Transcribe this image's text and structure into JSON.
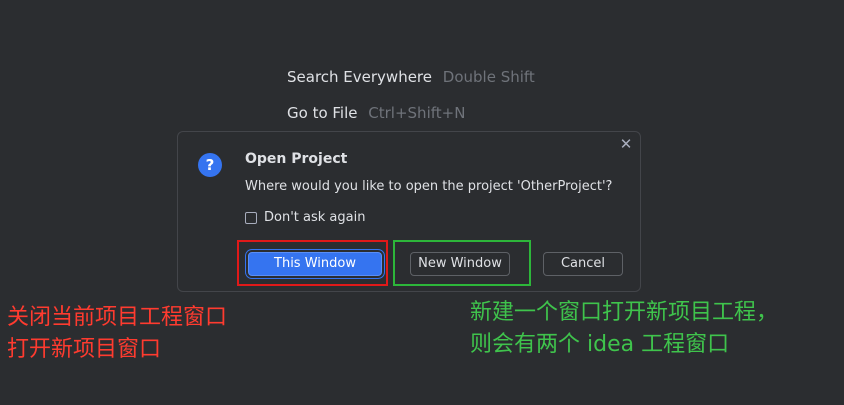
{
  "background_hints": [
    {
      "action": "Search Everywhere",
      "shortcut": "Double Shift"
    },
    {
      "action": "Go to File",
      "shortcut": "Ctrl+Shift+N"
    }
  ],
  "dialog": {
    "title": "Open Project",
    "message": "Where would you like to open the project 'OtherProject'?",
    "checkbox_label": "Don't ask again",
    "checkbox_checked": false,
    "buttons": {
      "this_window": "This Window",
      "new_window": "New Window",
      "cancel": "Cancel"
    },
    "icon": "question-icon",
    "close_icon": "close-icon"
  },
  "annotations": {
    "red": {
      "color": "#e01919",
      "lines": [
        "关闭当前项目工程窗口",
        "打开新项目窗口"
      ]
    },
    "green": {
      "color": "#2db63a",
      "lines": [
        "新建一个窗口打开新项目工程，",
        "则会有两个 idea 工程窗口"
      ]
    }
  },
  "colors": {
    "background": "#2b2d30",
    "accent": "#3574f0",
    "text": "#dfe1e5",
    "muted": "#6f737a"
  }
}
